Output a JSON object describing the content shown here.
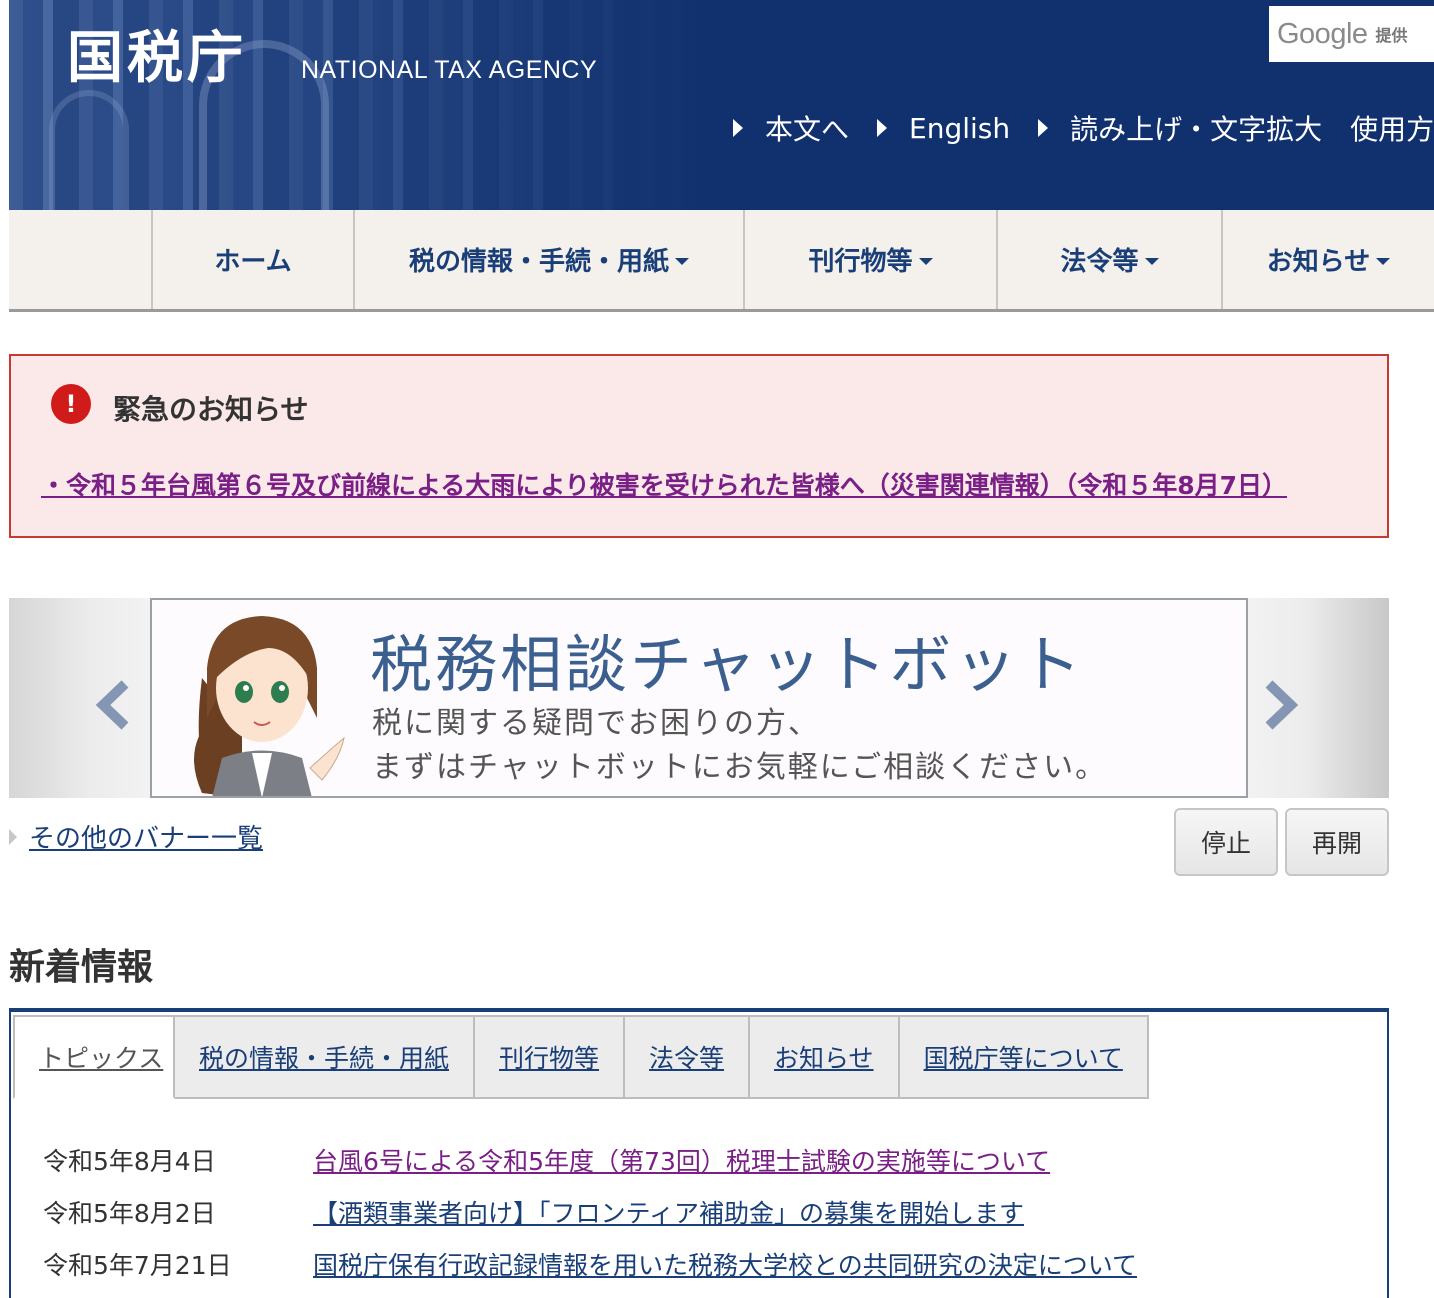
{
  "header": {
    "logo": "国税庁",
    "logo_en": "NATIONAL TAX AGENCY",
    "google_word": "Google",
    "google_provided": "提供",
    "util_links": [
      {
        "label": "本文へ"
      },
      {
        "label": "English"
      },
      {
        "label": "読み上げ・文字拡大"
      },
      {
        "label": "使用方法"
      }
    ]
  },
  "gnav": {
    "items": [
      {
        "label": "ホーム"
      },
      {
        "label": "税の情報・手続・用紙"
      },
      {
        "label": "刊行物等"
      },
      {
        "label": "法令等"
      },
      {
        "label": "お知らせ"
      }
    ]
  },
  "alert": {
    "icon": "!",
    "title": "緊急のお知らせ",
    "link": "・令和５年台風第６号及び前線による大雨により被害を受けられた皆様へ（災害関連情報）（令和５年8月7日）"
  },
  "carousel": {
    "banner_title": "税務相談チャットボット",
    "banner_line1": "税に関する疑問でお困りの方、",
    "banner_line2": "まずはチャットボットにお気軽にご相談ください。",
    "other_banners": "その他のバナー一覧",
    "stop_label": "停止",
    "resume_label": "再開"
  },
  "news": {
    "heading": "新着情報",
    "tabs": [
      {
        "label": "トピックス"
      },
      {
        "label": "税の情報・手続・用紙"
      },
      {
        "label": "刊行物等"
      },
      {
        "label": "法令等"
      },
      {
        "label": "お知らせ"
      },
      {
        "label": "国税庁等について"
      }
    ],
    "items": [
      {
        "date": "令和5年8月4日",
        "title": "台風6号による令和5年度（第73回）税理士試験の実施等について"
      },
      {
        "date": "令和5年8月2日",
        "title": "【酒類事業者向け】「フロンティア補助金」の募集を開始します"
      },
      {
        "date": "令和5年7月21日",
        "title": "国税庁保有行政記録情報を用いた税務大学校との共同研究の決定について"
      }
    ]
  },
  "colors": {
    "header_bg": "#10306e",
    "nav_text": "#1a3f78",
    "alert_border": "#c73a32",
    "alert_bg": "#fbe9e9",
    "visited_link": "#7a1f86"
  }
}
